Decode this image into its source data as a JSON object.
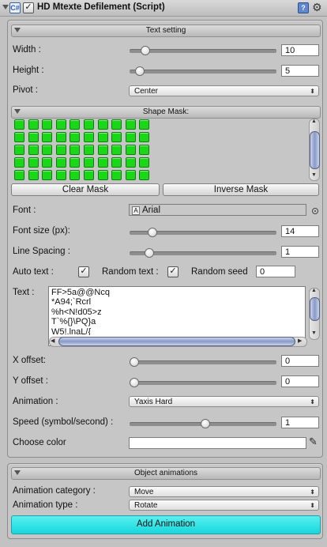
{
  "header": {
    "title": "HD Mtexte Defilement (Script)",
    "script_icon": "C#",
    "help_icon": "?",
    "enabled": true
  },
  "text_setting": {
    "section_title": "Text setting",
    "width": {
      "label": "Width :",
      "value": "10",
      "fraction": 0.08
    },
    "height": {
      "label": "Height :",
      "value": "5",
      "fraction": 0.04
    },
    "pivot": {
      "label": "Pivot :",
      "value": "Center"
    }
  },
  "shape_mask": {
    "section_title": "Shape Mask:",
    "rows": 5,
    "cols": 10,
    "clear_label": "Clear Mask",
    "inverse_label": "Inverse Mask"
  },
  "font": {
    "label": "Font :",
    "value": "Arial",
    "font_icon": "A"
  },
  "font_size": {
    "label": "Font size (px):",
    "value": "14",
    "fraction": 0.13
  },
  "line_spacing": {
    "label": "Line Spacing :",
    "value": "1",
    "fraction": 0.11
  },
  "options": {
    "auto_text_label": "Auto text :",
    "auto_text": true,
    "random_text_label": "Random text :",
    "random_text": true,
    "random_seed_label": "Random seed",
    "random_seed_value": "0"
  },
  "text": {
    "label": "Text :",
    "lines": [
      "FF>5a@@Ncq",
      "*A94;`Rcrl",
      "%h<N!d05>z",
      "T`%{}\\PQ}a",
      "W5!.lnaL/{"
    ]
  },
  "x_offset": {
    "label": "X offset:",
    "value": "0",
    "fraction": 0.0
  },
  "y_offset": {
    "label": "Y offset :",
    "value": "0",
    "fraction": 0.0
  },
  "animation": {
    "label": "Animation :",
    "value": "Yaxis Hard"
  },
  "speed": {
    "label": "Speed (symbol/second) :",
    "value": "1",
    "fraction": 0.51
  },
  "choose_color": {
    "label": "Choose color",
    "value": "#ffffff"
  },
  "object_animations": {
    "section_title": "Object animations",
    "category": {
      "label": "Animation category :",
      "value": "Move"
    },
    "type": {
      "label": "Animation type :",
      "value": "Rotate"
    },
    "add_label": "Add Animation"
  },
  "check_glyph": "✓",
  "arrows": {
    "up": "▲",
    "down": "▼",
    "left": "◀",
    "right": "▶"
  },
  "icons": {
    "gear": "⚙",
    "eyedropper": "✎",
    "dropdown": "⬍"
  }
}
